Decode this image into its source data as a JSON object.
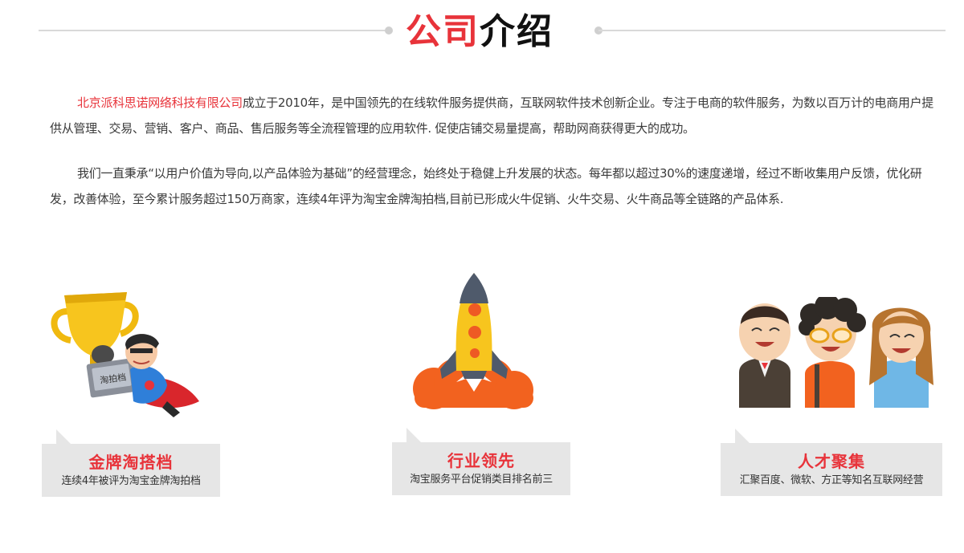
{
  "heading": {
    "title_red": "公司",
    "title_dark": "介绍"
  },
  "intro": {
    "company_name": "北京派科思诺网络科技有限公司",
    "paragraph1_rest": "成立于2010年，是中国领先的在线软件服务提供商，互联网软件技术创新企业。专注于电商的软件服务，为数以百万计的电商用户提供从管理、交易、营销、客户、商品、售后服务等全流程管理的应用软件. 促使店铺交易量提高，帮助网商获得更大的成功。",
    "paragraph2": "我们一直秉承“以用户价值为导向,以产品体验为基础”的经营理念，始终处于稳健上升发展的状态。每年都以超过30%的速度递增，经过不断收集用户反馈，优化研发，改善体验，至今累计服务超过150万商家，连续4年评为淘宝金牌淘拍档,目前已形成火牛促销、火牛交易、火牛商品等全链路的产品体系."
  },
  "features": [
    {
      "title": "金牌淘搭档",
      "subtitle": "连续4年被评为淘宝金牌淘拍档",
      "icon": "trophy-superhero-icon",
      "badge_text": "淘拍档"
    },
    {
      "title": "行业领先",
      "subtitle": "淘宝服务平台促销类目排名前三",
      "icon": "rocket-icon"
    },
    {
      "title": "人才聚集",
      "subtitle": "汇聚百度、微软、方正等知名互联网经营",
      "icon": "team-people-icon"
    }
  ],
  "colors": {
    "accent_red": "#e8333a",
    "card_bg": "#e6e6e6",
    "text": "#3a3a3a"
  }
}
